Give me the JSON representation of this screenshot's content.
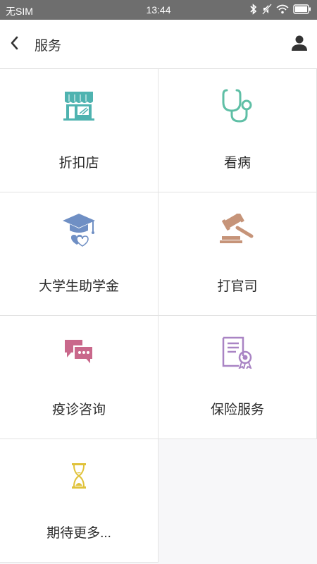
{
  "status_bar": {
    "carrier": "无SIM",
    "time": "13:44",
    "icons": [
      "bluetooth-icon",
      "mute-icon",
      "wifi-icon",
      "battery-icon"
    ]
  },
  "header": {
    "title": "服务",
    "back_icon": "chevron-left-icon",
    "profile_icon": "user-icon"
  },
  "services": [
    {
      "label": "折扣店",
      "icon": "store-icon",
      "color": "#4fb3b0"
    },
    {
      "label": "看病",
      "icon": "stethoscope-icon",
      "color": "#5fbfa6"
    },
    {
      "label": "大学生助学金",
      "icon": "graduation-cap-icon",
      "color": "#6f8fc4"
    },
    {
      "label": "打官司",
      "icon": "gavel-icon",
      "color": "#c69479"
    },
    {
      "label": "疫诊咨询",
      "icon": "chat-bubbles-icon",
      "color": "#c9688b"
    },
    {
      "label": "保险服务",
      "icon": "certificate-icon",
      "color": "#a984c4"
    },
    {
      "label": "期待更多...",
      "icon": "hourglass-icon",
      "color": "#e0c23a"
    }
  ]
}
